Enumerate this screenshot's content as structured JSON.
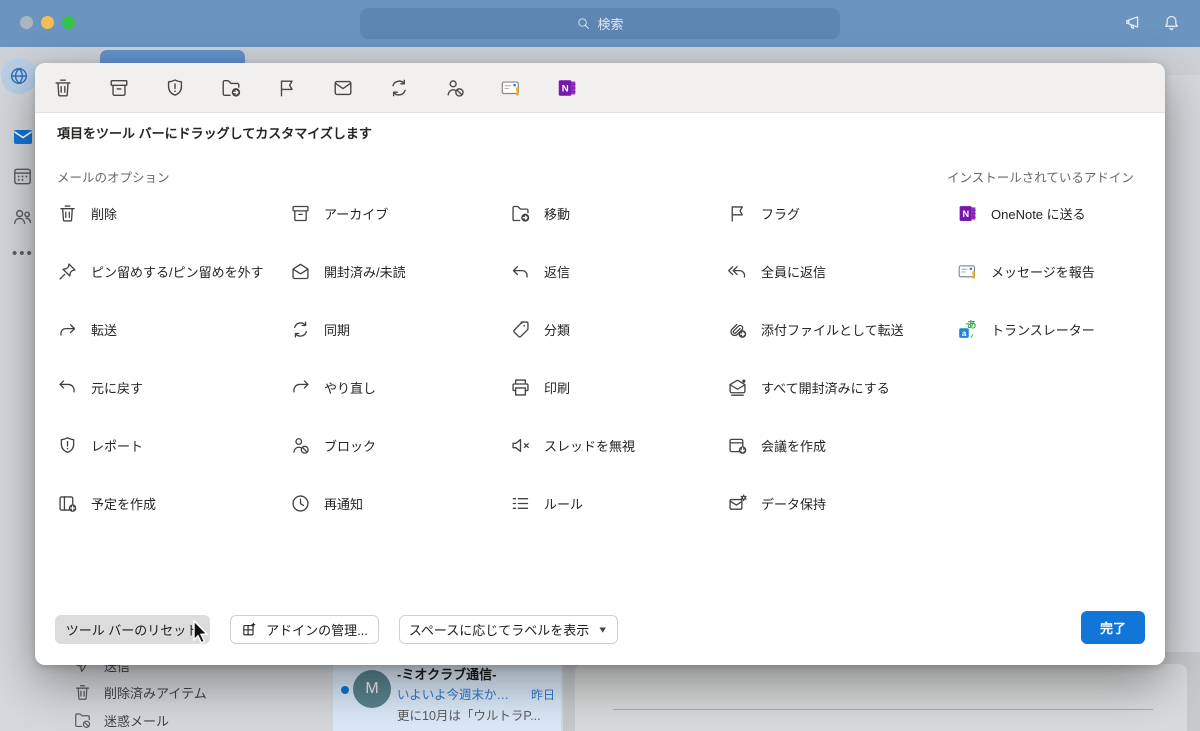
{
  "titlebar": {
    "search_placeholder": "検索",
    "traffic_lights": [
      "#a9b6c2",
      "#f6be50",
      "#36c24b"
    ]
  },
  "dialog": {
    "toolbar_icons": [
      "trash",
      "archive",
      "shield",
      "folder-move",
      "flag",
      "mail",
      "sync",
      "person-block",
      "mail-report",
      "onenote"
    ],
    "header": "項目をツール バーにドラッグしてカスタマイズします",
    "sections": {
      "mail_options": "メールのオプション",
      "installed_addins": "インストールされているアドイン"
    },
    "options": [
      {
        "id": "delete",
        "icon": "trash",
        "label": "削除",
        "row": 1,
        "col": 1
      },
      {
        "id": "archive",
        "icon": "archive",
        "label": "アーカイブ",
        "row": 1,
        "col": 2
      },
      {
        "id": "move",
        "icon": "folder-move",
        "label": "移動",
        "row": 1,
        "col": 3
      },
      {
        "id": "flag",
        "icon": "flag",
        "label": "フラグ",
        "row": 1,
        "col": 4
      },
      {
        "id": "pin",
        "icon": "pin",
        "label": "ピン留めする/ピン留めを外す",
        "row": 2,
        "col": 1
      },
      {
        "id": "read-unread",
        "icon": "mail-open",
        "label": "開封済み/未読",
        "row": 2,
        "col": 2
      },
      {
        "id": "reply",
        "icon": "reply",
        "label": "返信",
        "row": 2,
        "col": 3
      },
      {
        "id": "reply-all",
        "icon": "reply-all",
        "label": "全員に返信",
        "row": 2,
        "col": 4
      },
      {
        "id": "forward",
        "icon": "forward",
        "label": "転送",
        "row": 3,
        "col": 1
      },
      {
        "id": "sync",
        "icon": "sync",
        "label": "同期",
        "row": 3,
        "col": 2
      },
      {
        "id": "categorize",
        "icon": "tag",
        "label": "分類",
        "row": 3,
        "col": 3
      },
      {
        "id": "fwd-attach",
        "icon": "attach-forward",
        "label": "添付ファイルとして転送",
        "row": 3,
        "col": 4
      },
      {
        "id": "undo",
        "icon": "undo",
        "label": "元に戻す",
        "row": 4,
        "col": 1
      },
      {
        "id": "redo",
        "icon": "redo",
        "label": "やり直し",
        "row": 4,
        "col": 2
      },
      {
        "id": "print",
        "icon": "print",
        "label": "印刷",
        "row": 4,
        "col": 3
      },
      {
        "id": "mark-all-read",
        "icon": "mail-all-read",
        "label": "すべて開封済みにする",
        "row": 4,
        "col": 4
      },
      {
        "id": "report",
        "icon": "shield",
        "label": "レポート",
        "row": 5,
        "col": 1
      },
      {
        "id": "block",
        "icon": "person-block",
        "label": "ブロック",
        "row": 5,
        "col": 2
      },
      {
        "id": "ignore-thread",
        "icon": "mute",
        "label": "スレッドを無視",
        "row": 5,
        "col": 3
      },
      {
        "id": "create-meeting",
        "icon": "meeting",
        "label": "会議を作成",
        "row": 5,
        "col": 4
      },
      {
        "id": "create-event",
        "icon": "calendar-add",
        "label": "予定を作成",
        "row": 6,
        "col": 1
      },
      {
        "id": "snooze",
        "icon": "clock",
        "label": "再通知",
        "row": 6,
        "col": 2
      },
      {
        "id": "rules",
        "icon": "rules",
        "label": "ルール",
        "row": 6,
        "col": 3
      },
      {
        "id": "data-retention",
        "icon": "mail-gear",
        "label": "データ保持",
        "row": 6,
        "col": 4
      }
    ],
    "addins": [
      {
        "id": "onenote",
        "icon": "onenote",
        "label": "OneNote に送る",
        "row": 1
      },
      {
        "id": "report-msg",
        "icon": "mail-report",
        "label": "メッセージを報告",
        "row": 2
      },
      {
        "id": "translator",
        "icon": "translator",
        "label": "トランスレーター",
        "row": 3
      }
    ],
    "footer": {
      "reset_label": "ツール バーのリセット",
      "manage_addins_label": "アドインの管理...",
      "label_display_label": "スペースに応じてラベルを表示",
      "done_label": "完了"
    }
  },
  "background": {
    "sidebar_folders": [
      {
        "icon": "send",
        "label": "送信"
      },
      {
        "icon": "trash",
        "label": "削除済みアイテム"
      },
      {
        "icon": "junk-folder",
        "label": "迷惑メール"
      }
    ],
    "mail_item": {
      "avatar": "M",
      "sender": "-ミオクラブ通信-",
      "subject": "いよいよ今週末か…",
      "date": "昨日",
      "preview": "更に10月は「ウルトラP..."
    }
  },
  "colors": {
    "accent_blue": "#1276d8",
    "titlebar_blue": "#6b94bf",
    "done_button": "#1276d8",
    "onenote_purple": "#7719aa"
  }
}
